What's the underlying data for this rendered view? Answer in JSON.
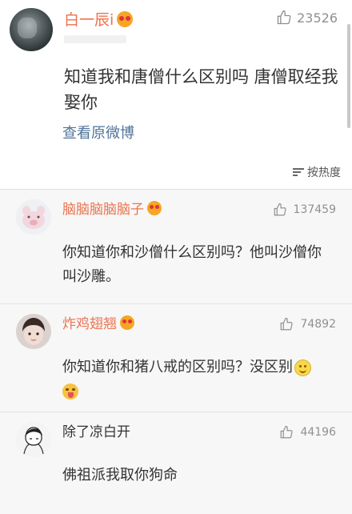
{
  "post": {
    "author": "白一辰i",
    "likes": "23526",
    "text": "知道我和唐僧什么区别吗   唐僧取经我娶你",
    "view_original": "查看原微博"
  },
  "sort": {
    "label": "按热度"
  },
  "comments": [
    {
      "author": "脑脑脑脑脑子",
      "likes": "137459",
      "text": "你知道你和沙僧什么区别吗？他叫沙僧你叫沙雕。",
      "verified_badge": true
    },
    {
      "author": "炸鸡翅翘",
      "likes": "74892",
      "text": "你知道你和猪八戒的区别吗？没区别",
      "verified_badge": true,
      "emojis": [
        "smile-emoji",
        "tongue-emoji"
      ]
    },
    {
      "author": "除了凉白开",
      "likes": "44196",
      "text": "佛祖派我取你狗命",
      "verified_badge": false
    }
  ],
  "colors": {
    "name_accent": "#eb7350",
    "link": "#50749a",
    "muted": "#909090",
    "comment_bg": "#f7f7f7"
  },
  "icons": {
    "like": "thumbs-up-icon",
    "sort": "sort-lines-icon",
    "badge": "vip-badge-icon"
  }
}
